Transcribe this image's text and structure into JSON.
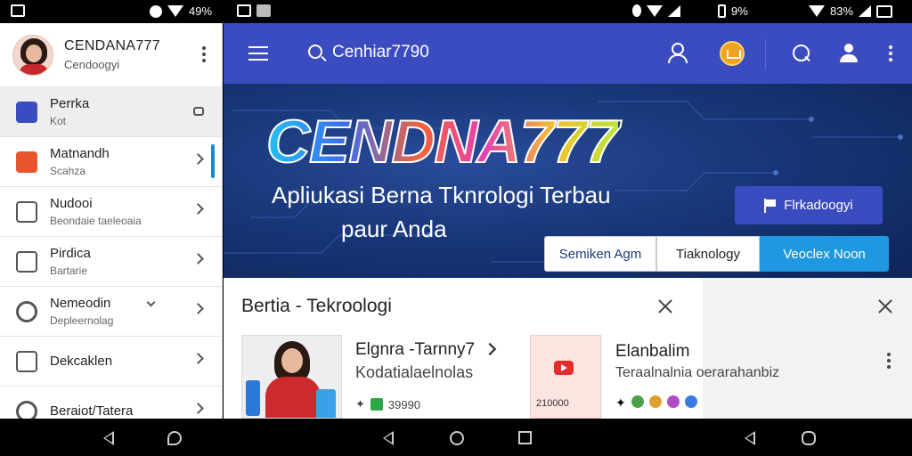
{
  "status_bar": {
    "left_pct": "49%",
    "mid_pct": "9%",
    "right_pct": "83%"
  },
  "drawer": {
    "profile_name": "CENDANA777",
    "profile_sub": "Cendoogyi",
    "items": [
      {
        "label": "Perrka",
        "sub": "Kot",
        "icon": "briefcase-icon",
        "color": "#3b4cc0"
      },
      {
        "label": "Matnandh",
        "sub": "Scahza",
        "icon": "bookmark-icon",
        "color": "#e8552d"
      },
      {
        "label": "Nudooi",
        "sub": "Beondaie taeleoaia",
        "icon": "list-icon",
        "color": "#555555"
      },
      {
        "label": "Pirdica",
        "sub": "Bartarie",
        "icon": "gallery-icon",
        "color": "#555555"
      },
      {
        "label": "Nemeodin",
        "sub": "Depleernolag",
        "icon": "gear-icon",
        "color": "#555555"
      },
      {
        "label": "Dekcaklen",
        "sub": "",
        "icon": "card-icon",
        "color": "#555555"
      },
      {
        "label": "Beraiot/Tatera",
        "sub": "",
        "icon": "globe-icon",
        "color": "#555555"
      }
    ]
  },
  "appbar": {
    "search_text": "Cenhiar7790",
    "color": "#3b4cc0"
  },
  "hero": {
    "brand": "CENDNA777",
    "line1": "Apliukasi Berna Tknrologi Terbau",
    "line2": "paur Anda",
    "cta_label": "Flrkadoogyi",
    "segments": [
      "Semiken Agm",
      "Tiaknology",
      "Veoclex Noon"
    ]
  },
  "news": {
    "title": "Bertia - Tekroologi",
    "card1": {
      "title": "Elgnra -Tarnny7",
      "sub": "Kodatialaelnolas",
      "meta": "39990"
    },
    "card2": {
      "title": "Elanbalim",
      "sub": "Teraalnalnia oerarahanbiz",
      "thumb_meta": "210000"
    }
  }
}
